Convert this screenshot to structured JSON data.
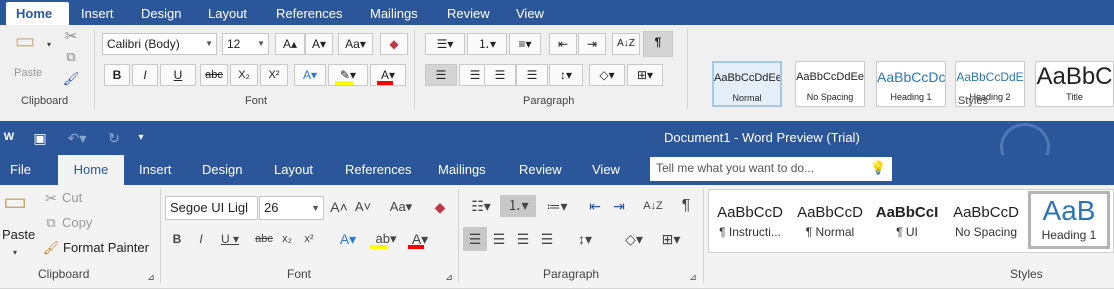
{
  "top_ribbon": {
    "tabs": [
      "Home",
      "Insert",
      "Design",
      "Layout",
      "References",
      "Mailings",
      "Review",
      "View"
    ],
    "clipboard": {
      "paste": "Paste",
      "group": "Clipboard"
    },
    "font": {
      "name": "Calibri (Body)",
      "size": "12",
      "bold": "B",
      "italic": "I",
      "underline": "U",
      "strike": "abc",
      "sub": "X₂",
      "sup": "X²",
      "group": "Font"
    },
    "paragraph": {
      "group": "Paragraph"
    },
    "styles": {
      "items": [
        {
          "preview": "AaBbCcDdEe",
          "name": "Normal"
        },
        {
          "preview": "AaBbCcDdEe",
          "name": "No Spacing"
        },
        {
          "preview": "AaBbCcDc",
          "name": "Heading 1"
        },
        {
          "preview": "AaBbCcDdE",
          "name": "Heading 2"
        },
        {
          "preview": "AaBbC",
          "name": "Title"
        }
      ],
      "group": "Styles"
    }
  },
  "window": {
    "title": "Document1 - Word Preview (Trial)"
  },
  "second_ribbon": {
    "tabs": [
      "File",
      "Home",
      "Insert",
      "Design",
      "Layout",
      "References",
      "Mailings",
      "Review",
      "View"
    ],
    "search_placeholder": "Tell me what you want to do...",
    "clipboard": {
      "cut": "Cut",
      "copy": "Copy",
      "format_painter": "Format Painter",
      "paste": "Paste",
      "group": "Clipboard"
    },
    "font": {
      "name": "Segoe UI Ligl",
      "size": "26",
      "group": "Font"
    },
    "paragraph": {
      "group": "Paragraph"
    },
    "styles": {
      "items": [
        {
          "preview": "AaBbCcD",
          "name": "¶ Instructi..."
        },
        {
          "preview": "AaBbCcD",
          "name": "¶ Normal"
        },
        {
          "preview": "AaBbCcI",
          "name": "¶ UI"
        },
        {
          "preview": "AaBbCcD",
          "name": "No Spacing"
        },
        {
          "preview": "AaB",
          "name": "Heading 1"
        }
      ],
      "group": "Styles"
    }
  },
  "colors": {
    "accent": "#2b579a",
    "highlight": "#ffff00",
    "font_color": "#ff0000"
  }
}
